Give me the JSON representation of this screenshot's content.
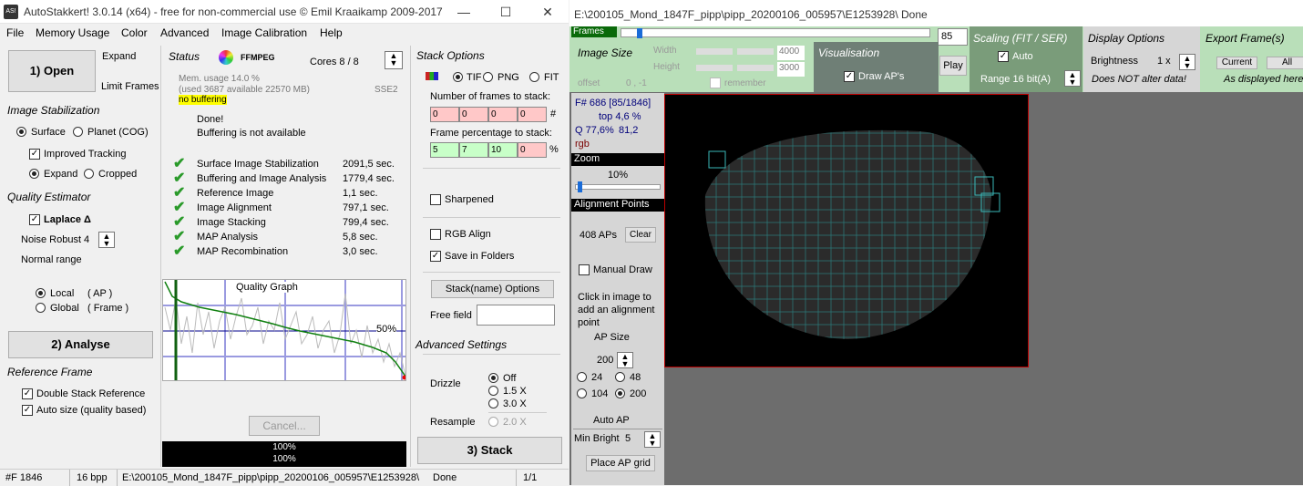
{
  "win1": {
    "title": "AutoStakkert! 3.0.14 (x64) - free for non-commercial use © Emil Kraaikamp 2009-2017",
    "icon_text": "AS!",
    "menu": [
      "File",
      "Memory Usage",
      "Color",
      "Advanced",
      "Image Calibration",
      "Help"
    ],
    "open_btn": "1) Open",
    "expand": "Expand",
    "limit_frames": "Limit Frames",
    "image_stab": "Image Stabilization",
    "surface": "Surface",
    "planet": "Planet (COG)",
    "improved_tracking": "Improved Tracking",
    "expand_r": "Expand",
    "cropped": "Cropped",
    "quality_est": "Quality Estimator",
    "laplace": "Laplace Δ",
    "noise_robust": "Noise Robust",
    "noise_val": "4",
    "normal_range": "Normal range",
    "local": "Local",
    "local_ap": "( AP )",
    "global": "Global",
    "global_frame": "( Frame )",
    "analyse_btn": "2) Analyse",
    "ref_frame": "Reference Frame",
    "double_stack": "Double Stack Reference",
    "auto_size": "Auto size (quality based)",
    "status_title": "Status",
    "ffmpeg": "FFMPEG",
    "cores": "Cores 8 / 8",
    "mem1": "Mem. usage 14.0 %",
    "mem2": "(used 3687 available 22570 MB)",
    "sse": "SSE2",
    "no_buffering": "no buffering",
    "done": "Done!",
    "buffering": "Buffering is not available",
    "tasks": [
      {
        "name": "Surface Image Stabilization",
        "time": "2091,5 sec."
      },
      {
        "name": "Buffering and Image Analysis",
        "time": "1779,4 sec."
      },
      {
        "name": "Reference Image",
        "time": "1,1 sec."
      },
      {
        "name": "Image Alignment",
        "time": "797,1 sec."
      },
      {
        "name": "Image Stacking",
        "time": "799,4 sec."
      },
      {
        "name": "MAP Analysis",
        "time": "5,8 sec."
      },
      {
        "name": "MAP Recombination",
        "time": "3,0 sec."
      }
    ],
    "quality_graph": "Quality Graph",
    "pct50": "50%",
    "cancel": "Cancel...",
    "prog1": "100%",
    "prog2": "100%",
    "stack_options": "Stack Options",
    "tif": "TIF",
    "png": "PNG",
    "fit": "FIT",
    "num_frames": "Number of frames to stack:",
    "frames_vals": [
      "0",
      "0",
      "0",
      "0"
    ],
    "hash": "#",
    "frame_pct": "Frame percentage to stack:",
    "pct_vals": [
      "5",
      "7",
      "10",
      "0"
    ],
    "pct_sign": "%",
    "sharpened": "Sharpened",
    "rgb_align": "RGB Align",
    "save_folders": "Save in Folders",
    "stackname_btn": "Stack(name) Options",
    "free_field": "Free field",
    "adv_settings": "Advanced Settings",
    "drizzle": "Drizzle",
    "off": "Off",
    "x15": "1.5 X",
    "x30": "3.0 X",
    "resample": "Resample",
    "x20": "2.0 X",
    "stack_btn": "3) Stack",
    "status_bar": {
      "frames": "#F 1846",
      "bpp": "16 bpp",
      "path": "E:\\200105_Mond_1847F_pipp\\pipp_20200106_005957\\E1253928\\",
      "state": "Done",
      "page": "1/1"
    }
  },
  "win2": {
    "title": "E:\\200105_Mond_1847F_pipp\\pipp_20200106_005957\\E1253928\\   Done",
    "frames_tab": "Frames",
    "frame_num": "85",
    "image_size": "Image Size",
    "width": "Width",
    "height": "Height",
    "w_val": "4000",
    "h_val": "3000",
    "offset": "offset",
    "offset_val": "0 , -1",
    "remember": "remember",
    "visualisation": "Visualisation",
    "draw_aps": "Draw AP's",
    "play": "Play",
    "scaling": "Scaling (FIT / SER)",
    "auto": "Auto",
    "range": "Range 16 bit(A)",
    "display_opts": "Display Options",
    "brightness": "Brightness",
    "bright_val": "1 x",
    "not_alter": "Does NOT alter data!",
    "export": "Export Frame(s)",
    "current": "Current",
    "all": "All",
    "as_displayed": "As displayed here",
    "frame_info": "F# 686 [85/1846]",
    "top": "top 4,6 %",
    "q": "Q 77,6%",
    "q2": "81,2",
    "rgb": "rgb",
    "zoom": "Zoom",
    "zoom_val": "10%",
    "align_points": "Alignment Points",
    "aps": "408 APs",
    "clear": "Clear",
    "manual_draw": "Manual Draw",
    "click_info": "Click in image to add an alignment point",
    "ap_size": "AP Size",
    "ap_size_val": "200",
    "s24": "24",
    "s48": "48",
    "s104": "104",
    "s200": "200",
    "auto_ap": "Auto AP",
    "min_bright": "Min Bright",
    "min_bright_val": "5",
    "place_grid": "Place AP grid"
  }
}
